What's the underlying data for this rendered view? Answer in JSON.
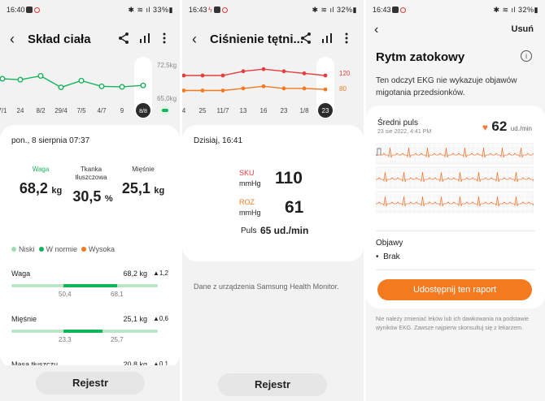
{
  "panel1": {
    "status": {
      "time": "16:40",
      "battery": "33%"
    },
    "title": "Skład ciała",
    "chart": {
      "ylabels": [
        "72,5kg",
        "65,0kg"
      ],
      "xlabels": [
        "7/1",
        "24",
        "8/2",
        "29/4",
        "7/5",
        "4/7",
        "9",
        "8/8"
      ],
      "selected": "8/8"
    },
    "chart_data": {
      "type": "line",
      "categories": [
        "7/1",
        "24",
        "8/2",
        "29/4",
        "7/5",
        "4/7",
        "9",
        "8/8"
      ],
      "series": [
        {
          "values": [
            69.6,
            69.4,
            70.2,
            67.8,
            69.2,
            68.0,
            67.9,
            68.2
          ]
        }
      ],
      "ylim": [
        65.0,
        72.5
      ]
    },
    "date": "pon., 8 sierpnia 07:37",
    "metrics": [
      {
        "label": "Waga",
        "value": "68,2",
        "unit": "kg"
      },
      {
        "label": "Tkanka tłuszczowa",
        "value": "30,5",
        "unit": "%"
      },
      {
        "label": "Mięśnie",
        "value": "25,1",
        "unit": "kg"
      }
    ],
    "legend": [
      "Niski",
      "W normie",
      "Wysoka"
    ],
    "rows": [
      {
        "label": "Waga",
        "value": "68,2 kg",
        "change": "▲1,2",
        "low": "50,4",
        "high": "68,1",
        "level": 0.92
      },
      {
        "label": "Mięśnie",
        "value": "25,1 kg",
        "change": "▲0,6",
        "low": "23,3",
        "high": "25,7",
        "level": 0.62
      },
      {
        "label": "Masa tłuszczu",
        "value": "20,8 kg",
        "change": "▲0,1"
      }
    ],
    "footer": "Rejestr"
  },
  "panel2": {
    "status": {
      "time": "16:43",
      "battery": "32%"
    },
    "title": "Ciśnienie tętni...",
    "chart": {
      "ylabels": [
        "120",
        "80"
      ],
      "xlabels": [
        "4",
        "25",
        "11/7",
        "13",
        "16",
        "23",
        "1/8",
        "23"
      ],
      "selected": "23"
    },
    "chart_data": {
      "type": "line",
      "categories": [
        "4",
        "25",
        "11/7",
        "13",
        "16",
        "23",
        "1/8",
        "23"
      ],
      "series": [
        {
          "values": [
            110,
            110,
            110,
            114,
            116,
            114,
            112,
            110
          ]
        },
        {
          "values": [
            60,
            60,
            60,
            62,
            64,
            62,
            62,
            61
          ]
        }
      ]
    },
    "date": "Dzisiaj, 16:41",
    "sys": {
      "label": "SKU",
      "unit": "mmHg",
      "value": "110"
    },
    "dia": {
      "label": "ROZ",
      "unit": "mmHg",
      "value": "61"
    },
    "pulse": {
      "label": "Puls",
      "value": "65 ud./min"
    },
    "source": "Dane z urządzenia Samsung Health Monitor.",
    "footer": "Rejestr"
  },
  "panel3": {
    "status": {
      "time": "16:43",
      "battery": "32%"
    },
    "share_top": "Usuń",
    "heading": "Rytm zatokowy",
    "desc": "Ten odczyt EKG nie wykazuje objawów migotania przedsionków.",
    "avg_label": "Średni puls",
    "avg_date": "23 sie 2022, 4:41 PM",
    "avg_value": "62",
    "avg_unit": "ud./min",
    "symptoms_label": "Objawy",
    "symptom": "Brak",
    "share_button": "Udostępnij ten raport",
    "disclaimer": "Nie należy zmieniać leków lub ich dawkowania na podstawie wyników EKG. Zawsze najpierw skonsultuj się z lekarzem."
  },
  "colors": {
    "green": "#17b35a",
    "orange": "#f47a20",
    "red": "#e53e3e",
    "heart": "#f07a3a"
  }
}
